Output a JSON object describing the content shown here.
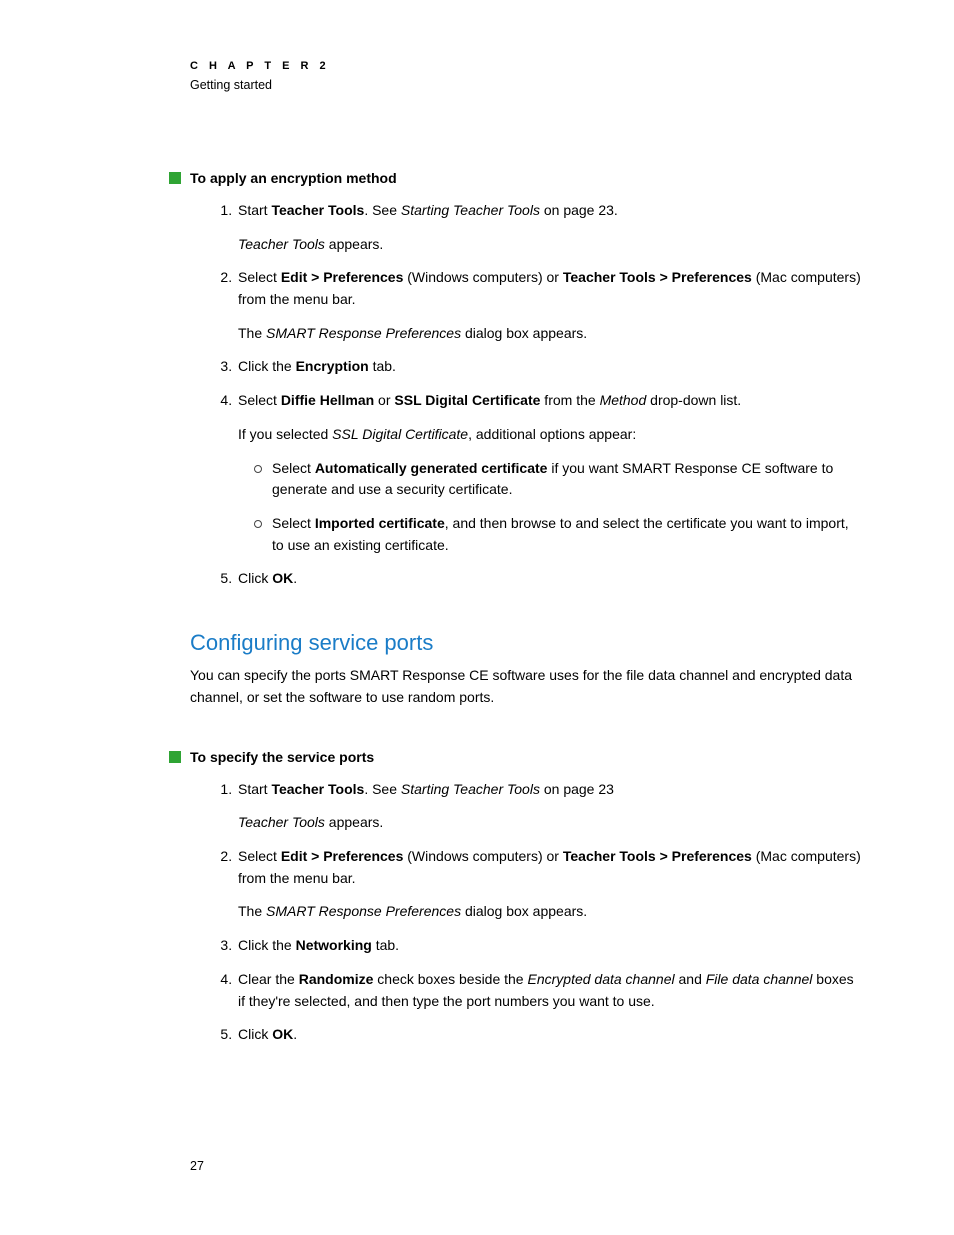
{
  "header": {
    "chapter_label": "C H A P T E R   2",
    "section_label": "Getting started"
  },
  "proc1": {
    "title": "To apply an encryption method",
    "step1_pre": "Start ",
    "step1_b1": "Teacher Tools",
    "step1_mid": ". See ",
    "step1_i1": "Starting Teacher Tools",
    "step1_post": " on page 23.",
    "step1_result_i": "Teacher Tools",
    "step1_result_post": " appears.",
    "step2_pre": "Select ",
    "step2_b1": "Edit > Preferences",
    "step2_mid1": " (Windows computers) or ",
    "step2_b2": "Teacher Tools > Preferences",
    "step2_mid2": " (Mac computers) from the menu bar.",
    "step2_result_pre": "The ",
    "step2_result_i": "SMART Response Preferences",
    "step2_result_post": " dialog box appears.",
    "step3_pre": "Click the ",
    "step3_b1": "Encryption",
    "step3_post": " tab.",
    "step4_pre": "Select ",
    "step4_b1": "Diffie Hellman",
    "step4_mid1": " or ",
    "step4_b2": "SSL Digital Certificate",
    "step4_mid2": " from the ",
    "step4_i1": "Method",
    "step4_post": " drop-down list.",
    "step4_result_pre": "If you selected ",
    "step4_result_i": "SSL Digital Certificate",
    "step4_result_post": ", additional options appear:",
    "step4_sub1_pre": "Select ",
    "step4_sub1_b": "Automatically generated certificate",
    "step4_sub1_post": " if you want SMART Response CE software to generate and use a security certificate.",
    "step4_sub2_pre": "Select ",
    "step4_sub2_b": "Imported certificate",
    "step4_sub2_post": ", and then browse to and select the certificate you want to import, to use an existing certificate.",
    "step5_pre": "Click ",
    "step5_b1": "OK",
    "step5_post": "."
  },
  "section2": {
    "heading": "Configuring service ports",
    "intro": "You can specify the ports SMART Response CE software uses for the file data channel and encrypted data channel, or set the software to use random ports."
  },
  "proc2": {
    "title": "To specify the service ports",
    "step1_pre": "Start ",
    "step1_b1": "Teacher Tools",
    "step1_mid": ". See ",
    "step1_i1": "Starting Teacher Tools",
    "step1_post": " on page 23",
    "step1_result_i": "Teacher Tools",
    "step1_result_post": " appears.",
    "step2_pre": "Select ",
    "step2_b1": "Edit > Preferences",
    "step2_mid1": " (Windows computers) or ",
    "step2_b2": "Teacher Tools > Preferences",
    "step2_mid2": " (Mac computers) from the menu bar.",
    "step2_result_pre": "The ",
    "step2_result_i": "SMART Response Preferences",
    "step2_result_post": " dialog box appears.",
    "step3_pre": "Click the ",
    "step3_b1": "Networking",
    "step3_post": " tab.",
    "step4_pre": "Clear the ",
    "step4_b1": "Randomize",
    "step4_mid1": " check boxes beside the ",
    "step4_i1": "Encrypted data channel",
    "step4_mid2": " and ",
    "step4_i2": "File data channel",
    "step4_post": " boxes if they're selected, and then type the port numbers you want to use.",
    "step5_pre": "Click ",
    "step5_b1": "OK",
    "step5_post": "."
  },
  "footer": {
    "page_number": "27"
  }
}
